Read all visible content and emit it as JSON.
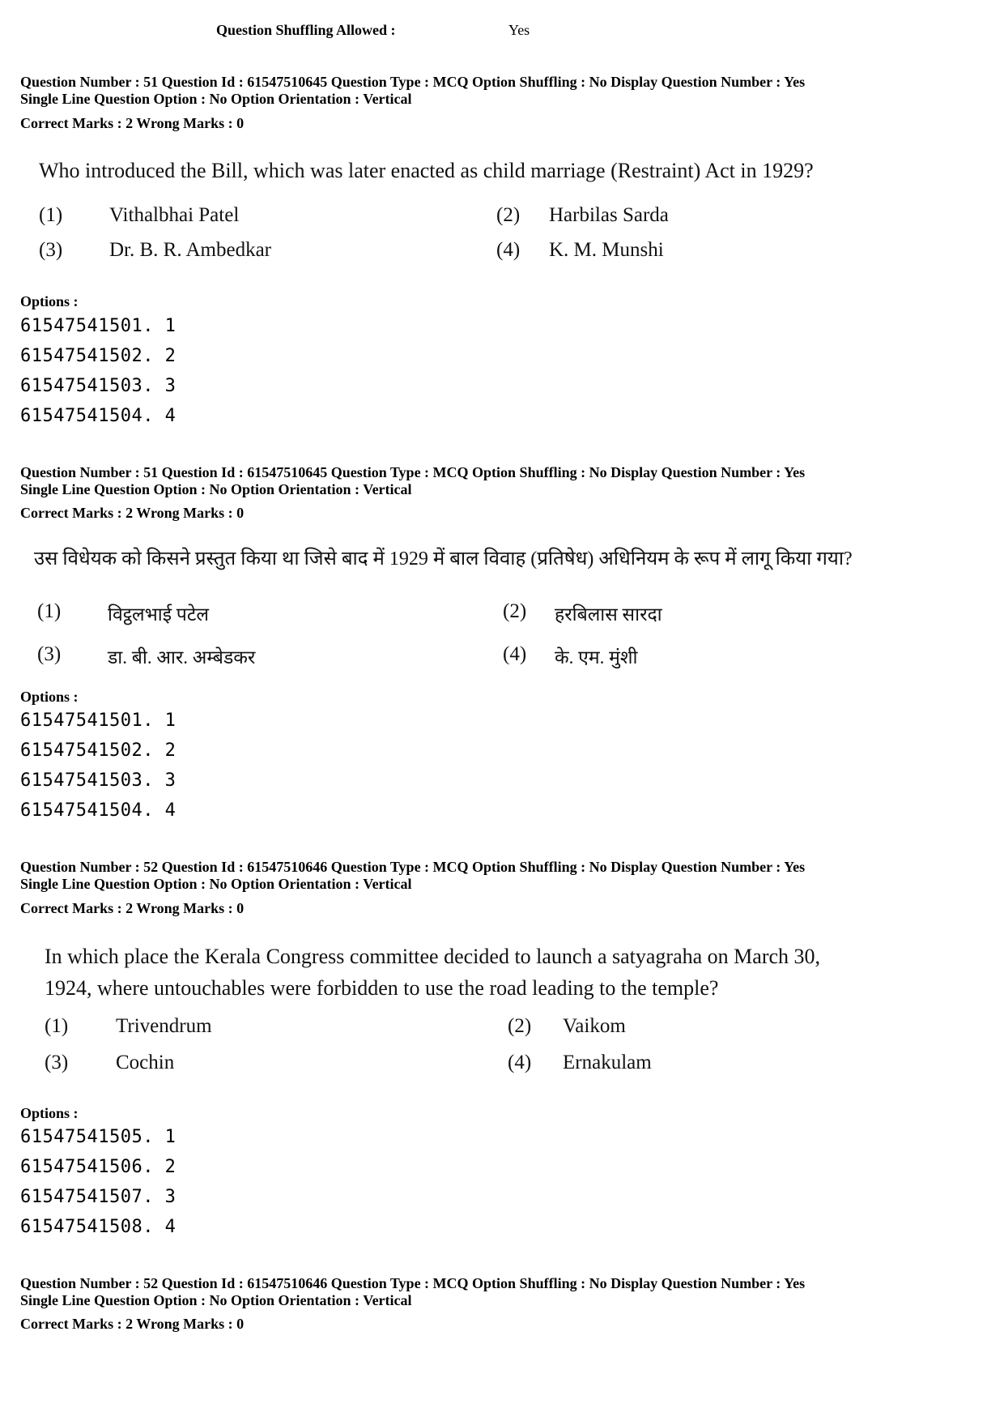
{
  "header": {
    "shuffle_label": "Question Shuffling Allowed :",
    "shuffle_value": "Yes"
  },
  "blocks": [
    {
      "meta_line1": "Question Number : 51  Question Id : 61547510645  Question Type : MCQ  Option Shuffling : No  Display Question Number : Yes",
      "meta_line2": "Single Line Question Option : No  Option Orientation : Vertical",
      "marks": "Correct Marks : 2  Wrong Marks : 0",
      "question": [
        "Who introduced the Bill, which was later enacted as child marriage (Restraint) Act in 1929?"
      ],
      "choices": [
        {
          "num": "(1)",
          "text": "Vithalbhai Patel"
        },
        {
          "num": "(2)",
          "text": "Harbilas Sarda"
        },
        {
          "num": "(3)",
          "text": "Dr. B. R. Ambedkar"
        },
        {
          "num": "(4)",
          "text": "K. M. Munshi"
        }
      ],
      "options_label": "Options :",
      "option_ids": [
        "61547541501. 1",
        "61547541502. 2",
        "61547541503. 3",
        "61547541504. 4"
      ]
    },
    {
      "meta_line1": "Question Number : 51  Question Id : 61547510645  Question Type : MCQ  Option Shuffling : No  Display Question Number : Yes",
      "meta_line2": "Single Line Question Option : No  Option Orientation : Vertical",
      "marks": "Correct Marks : 2  Wrong Marks : 0",
      "question": [
        "उस विधेयक को किसने प्रस्तुत किया था जिसे बाद में 1929 में बाल विवाह (प्रतिषेध) अधिनियम के रूप में लागू किया गया?"
      ],
      "choices": [
        {
          "num": "(1)",
          "text": "विट्ठलभाई पटेल"
        },
        {
          "num": "(2)",
          "text": "हरबिलास सारदा"
        },
        {
          "num": "(3)",
          "text": "डा. बी. आर. अम्बेडकर"
        },
        {
          "num": "(4)",
          "text": "के. एम. मुंशी"
        }
      ],
      "options_label": "Options :",
      "option_ids": [
        "61547541501. 1",
        "61547541502. 2",
        "61547541503. 3",
        "61547541504. 4"
      ]
    },
    {
      "meta_line1": "Question Number : 52  Question Id : 61547510646  Question Type : MCQ  Option Shuffling : No  Display Question Number : Yes",
      "meta_line2": "Single Line Question Option : No  Option Orientation : Vertical",
      "marks": "Correct Marks : 2  Wrong Marks : 0",
      "question": [
        "In which place the Kerala Congress committee decided to launch a satyagraha on March 30,",
        "1924, where untouchables were forbidden to use the road leading to the temple?"
      ],
      "choices": [
        {
          "num": "(1)",
          "text": "Trivendrum"
        },
        {
          "num": "(2)",
          "text": "Vaikom"
        },
        {
          "num": "(3)",
          "text": "Cochin"
        },
        {
          "num": "(4)",
          "text": "Ernakulam"
        }
      ],
      "options_label": "Options :",
      "option_ids": [
        "61547541505. 1",
        "61547541506. 2",
        "61547541507. 3",
        "61547541508. 4"
      ]
    },
    {
      "meta_line1": "Question Number : 52  Question Id : 61547510646  Question Type : MCQ  Option Shuffling : No  Display Question Number : Yes",
      "meta_line2": "Single Line Question Option : No  Option Orientation : Vertical",
      "marks": "Correct Marks : 2  Wrong Marks : 0"
    }
  ]
}
